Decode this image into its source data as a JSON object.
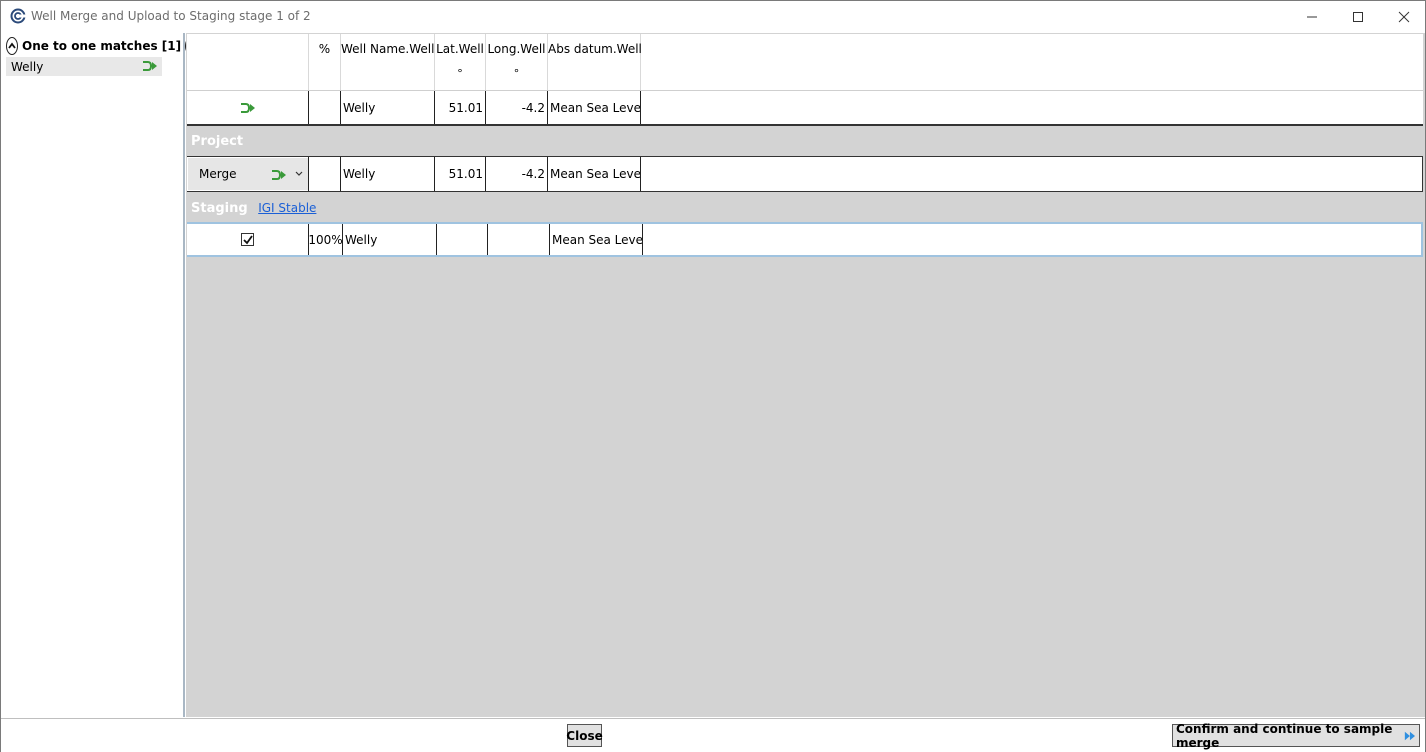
{
  "window": {
    "title": "Well Merge and Upload to Staging stage 1 of 2"
  },
  "left_panel": {
    "header": "One to one matches [1]",
    "items": [
      {
        "label": "Welly"
      }
    ]
  },
  "grid": {
    "columns": [
      {
        "label": "",
        "unit": ""
      },
      {
        "label": "%",
        "unit": ""
      },
      {
        "label": "Well Name.Well",
        "unit": ""
      },
      {
        "label": "Lat.Well",
        "unit": "°"
      },
      {
        "label": "Long.Well",
        "unit": "°"
      },
      {
        "label": "Abs datum.Well",
        "unit": ""
      }
    ],
    "result_row": {
      "name": "Welly",
      "lat": "51.01",
      "long": "-4.2",
      "datum": "Mean Sea Level"
    },
    "project": {
      "label": "Project",
      "action": "Merge",
      "row": {
        "name": "Welly",
        "lat": "51.01",
        "long": "-4.2",
        "datum": "Mean Sea Level"
      }
    },
    "staging": {
      "label": "Staging",
      "link": "IGI Stable",
      "row": {
        "checked": true,
        "percent": "100%",
        "name": "Welly",
        "lat": "",
        "long": "",
        "datum": "Mean Sea Level"
      }
    }
  },
  "footer": {
    "close_label": "Close",
    "confirm_label": "Confirm and continue to sample merge"
  },
  "colors": {
    "arrow_green": "#3a9a3a",
    "panel_gray": "#d3d3d3",
    "link_blue": "#1a5fd6",
    "confirm_arrow_blue": "#2f8fe0"
  }
}
